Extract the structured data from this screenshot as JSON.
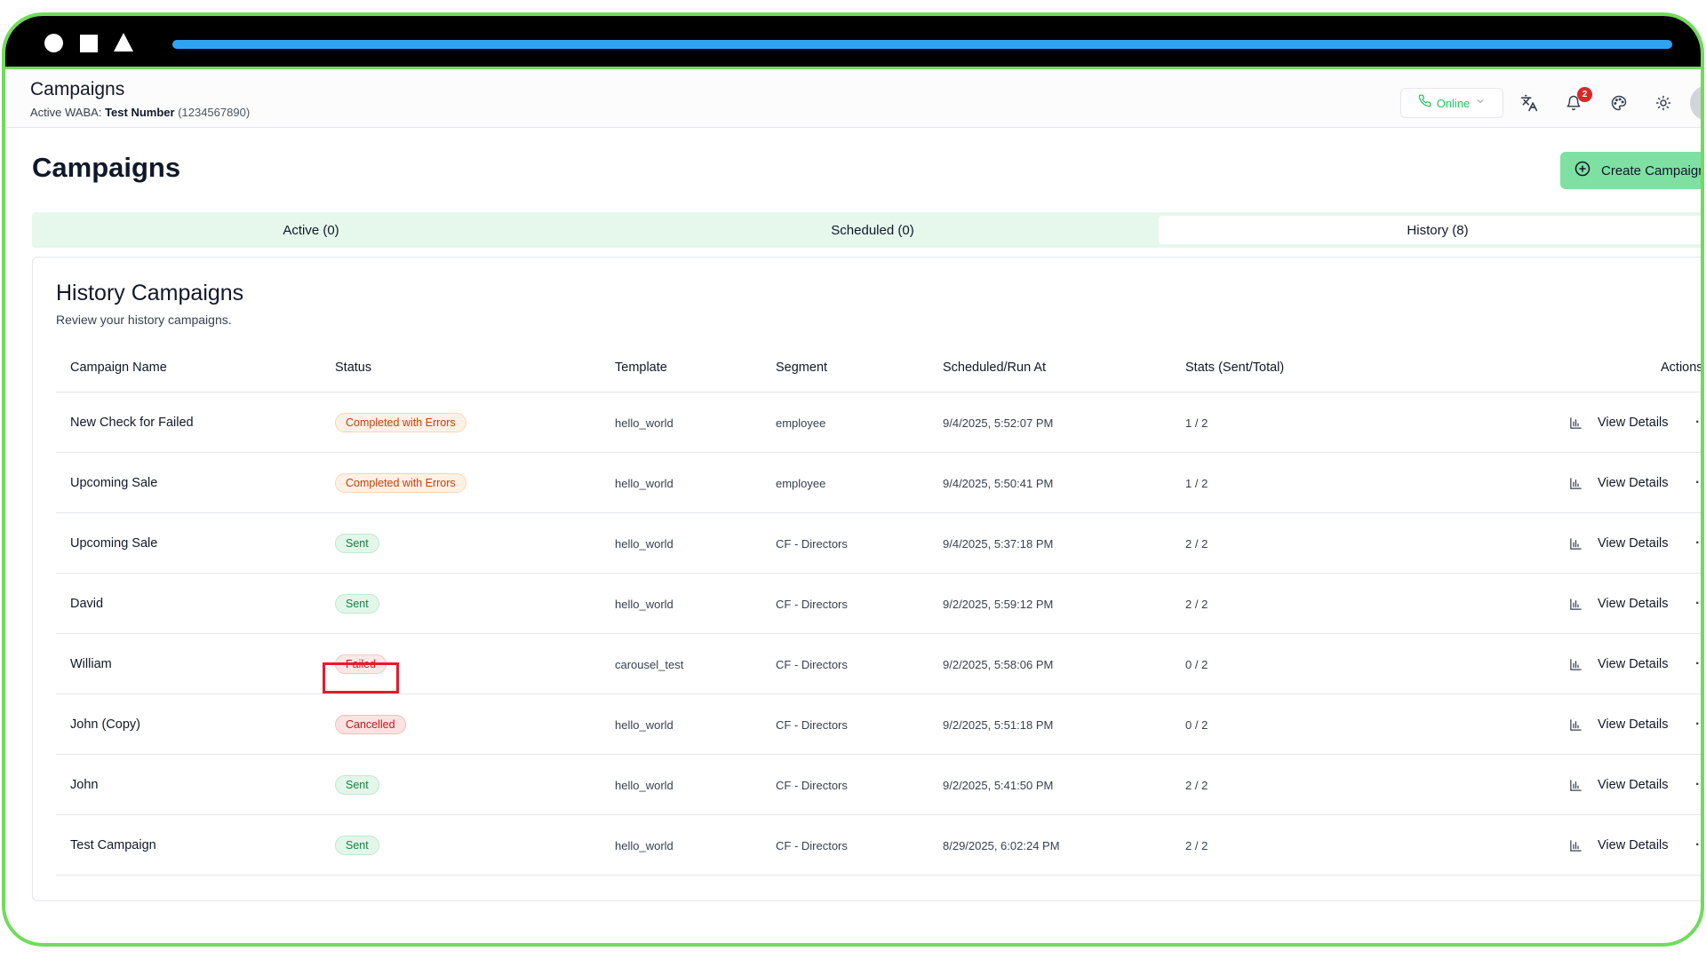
{
  "window": {
    "progress": 1.0,
    "colors": {
      "frame_border": "#6fdc5a",
      "progress": "#2ea3f2",
      "accent": "#7ee0a2"
    }
  },
  "header": {
    "title": "Campaigns",
    "waba_label": "Active WABA:",
    "waba_number": "Test Number",
    "waba_id": "(1234567890)",
    "status_label": "Online",
    "notification_count": "2",
    "icons": [
      "phone-icon",
      "chevron-down-icon",
      "translate-icon",
      "bell-icon",
      "palette-icon",
      "sun-icon"
    ]
  },
  "page": {
    "title": "Campaigns",
    "create_button": "Create Campaign"
  },
  "tabs": [
    {
      "label": "Active (0)",
      "active": false
    },
    {
      "label": "Scheduled (0)",
      "active": false
    },
    {
      "label": "History (8)",
      "active": true
    }
  ],
  "card": {
    "title": "History Campaigns",
    "subtitle": "Review your history campaigns."
  },
  "table": {
    "columns": [
      "Campaign Name",
      "Status",
      "Template",
      "Segment",
      "Scheduled/Run At",
      "Stats (Sent/Total)",
      "Actions"
    ],
    "rows": [
      {
        "name": "New Check for Failed",
        "status": "Completed with Errors",
        "status_kind": "warn",
        "template": "hello_world",
        "segment": "employee",
        "run_at": "9/4/2025, 5:52:07 PM",
        "stats": "1 / 2",
        "action": "View Details"
      },
      {
        "name": "Upcoming Sale",
        "status": "Completed with Errors",
        "status_kind": "warn",
        "template": "hello_world",
        "segment": "employee",
        "run_at": "9/4/2025, 5:50:41 PM",
        "stats": "1 / 2",
        "action": "View Details"
      },
      {
        "name": "Upcoming Sale",
        "status": "Sent",
        "status_kind": "sent",
        "template": "hello_world",
        "segment": "CF - Directors",
        "run_at": "9/4/2025, 5:37:18 PM",
        "stats": "2 / 2",
        "action": "View Details"
      },
      {
        "name": "David",
        "status": "Sent",
        "status_kind": "sent",
        "template": "hello_world",
        "segment": "CF - Directors",
        "run_at": "9/2/2025, 5:59:12 PM",
        "stats": "2 / 2",
        "action": "View Details"
      },
      {
        "name": "William",
        "status": "Failed",
        "status_kind": "fail",
        "template": "carousel_test",
        "segment": "CF - Directors",
        "run_at": "9/2/2025, 5:58:06 PM",
        "stats": "0 / 2",
        "action": "View Details"
      },
      {
        "name": "John (Copy)",
        "status": "Cancelled",
        "status_kind": "cancel",
        "template": "hello_world",
        "segment": "CF - Directors",
        "run_at": "9/2/2025, 5:51:18 PM",
        "stats": "0 / 2",
        "action": "View Details"
      },
      {
        "name": "John",
        "status": "Sent",
        "status_kind": "sent",
        "template": "hello_world",
        "segment": "CF - Directors",
        "run_at": "9/2/2025, 5:41:50 PM",
        "stats": "2 / 2",
        "action": "View Details"
      },
      {
        "name": "Test Campaign",
        "status": "Sent",
        "status_kind": "sent",
        "template": "hello_world",
        "segment": "CF - Directors",
        "run_at": "8/29/2025, 6:02:24 PM",
        "stats": "2 / 2",
        "action": "View Details"
      }
    ]
  }
}
